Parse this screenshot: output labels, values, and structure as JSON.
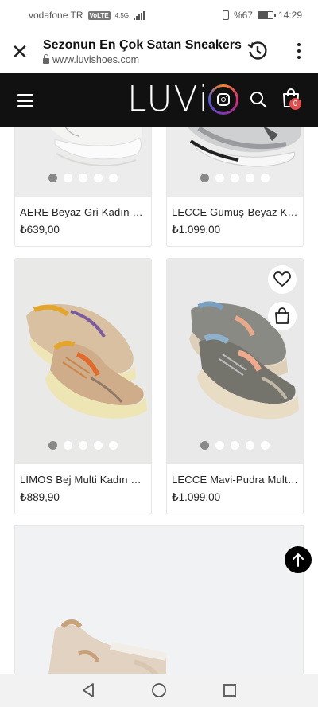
{
  "status": {
    "carrier": "vodafone TR",
    "volte": "VoLTE",
    "network": "4,5G",
    "battery": "%67",
    "battery_level": 0.67,
    "time": "14:29"
  },
  "browser": {
    "page_title": "Sezonun En Çok Satan Sneakers",
    "url": "www.luvishoes.com"
  },
  "site_header": {
    "logo": "LUVi",
    "cart_count": "0",
    "brand_color": "#111111",
    "badge_color": "#e74c4c"
  },
  "products": [
    {
      "name": "AERE Beyaz Gri Kadın Spor Ayakkabı",
      "price": "₺639,00",
      "image_slides": 5,
      "active_slide": 1
    },
    {
      "name": "LECCE Gümüş-Beyaz Kadın Sneaker",
      "price": "₺1.099,00",
      "image_slides": 5,
      "active_slide": 1
    },
    {
      "name": "LİMOS Bej Multi Kadın Sneaker",
      "price": "₺889,90",
      "image_slides": 5,
      "active_slide": 1
    },
    {
      "name": "LECCE Mavi-Pudra Multi Kadın Sneaker",
      "price": "₺1.099,00",
      "image_slides": 5,
      "active_slide": 1
    }
  ],
  "icons": {
    "close": "close-icon",
    "history": "history-icon",
    "menu": "more-vert-icon",
    "hamburger": "hamburger-icon",
    "instagram": "instagram-icon",
    "search": "search-icon",
    "cart": "shopping-bag-icon",
    "favorite": "heart-icon",
    "add_to_bag": "shopping-bag-icon",
    "scroll_top": "arrow-up-icon",
    "nav_back": "triangle-back-icon",
    "nav_home": "circle-home-icon",
    "nav_recent": "square-recent-icon"
  }
}
